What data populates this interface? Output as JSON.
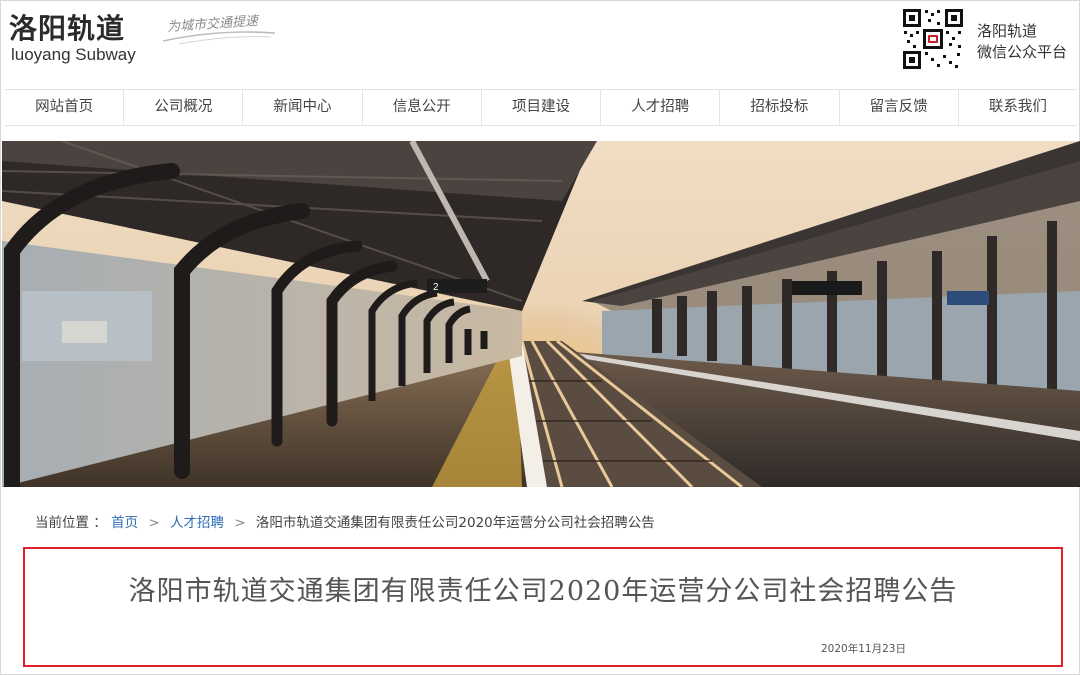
{
  "header": {
    "logo_cn": "洛阳轨道",
    "logo_en": "luoyang Subway",
    "slogan": "为城市交通提速",
    "wechat_line1": "洛阳轨道",
    "wechat_line2": "微信公众平台",
    "qr_icon": "qr-code-icon"
  },
  "nav": {
    "items": [
      "网站首页",
      "公司概况",
      "新闻中心",
      "信息公开",
      "项目建设",
      "人才招聘",
      "招标投标",
      "留言反馈",
      "联系我们"
    ]
  },
  "breadcrumb": {
    "prefix": "当前位置 ：",
    "home": "首页",
    "section": "人才招聘",
    "current": "洛阳市轨道交通集团有限责任公司2020年运营分公司社会招聘公告",
    "separator_icon": "chevron-right-icon"
  },
  "article": {
    "title": "洛阳市轨道交通集团有限责任公司2020年运营分公司社会招聘公告",
    "date": "2020年11月23日",
    "highlight_color": "#e0212b"
  },
  "banner": {
    "platform_number": "2"
  }
}
